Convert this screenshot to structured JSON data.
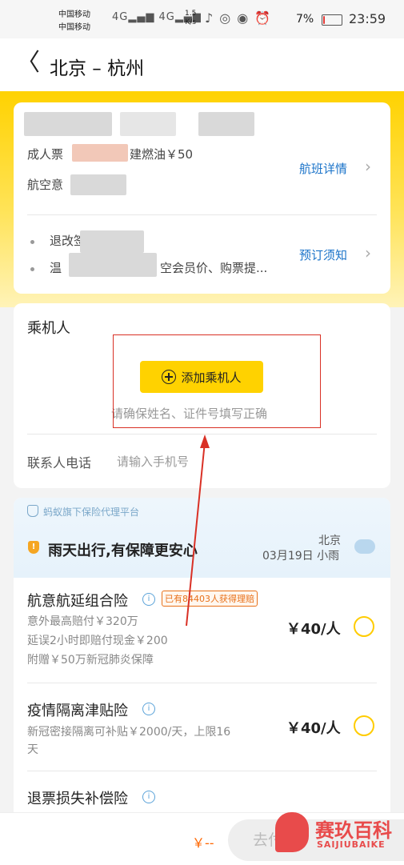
{
  "status_bar": {
    "carrier_1": "中国移动",
    "carrier_2": "中国移动",
    "signal": "4G▂▄▆ 4G▂▄▆",
    "speed_value": "1.5",
    "speed_unit": "K/s",
    "battery_pct": "7%",
    "battery_level": 0.07,
    "time": "23:59"
  },
  "header": {
    "back_glyph": "〈",
    "route": "北京 – 杭州"
  },
  "flight_card": {
    "adult_ticket": "成人票",
    "fuel": "建燃油￥50",
    "insurance": "航空意",
    "flight_details": "航班详情",
    "refund": "退改签",
    "tip": "温",
    "tip_tail": "空会员价、购票提...",
    "booking_notice": "预订须知"
  },
  "passenger": {
    "title": "乘机人",
    "add_button": "添加乘机人",
    "hint": "请确保姓名、证件号填写正确",
    "contact_label": "联系人电话",
    "contact_placeholder": "请输入手机号"
  },
  "insurance": {
    "platform": "蚂蚁旗下保险代理平台",
    "banner_title": "雨天出行,有保障更安心",
    "weather_city": "北京",
    "weather_date": "03月19日 小雨",
    "items": [
      {
        "name": "航意航延组合险",
        "badge": "已有84403人获得理赔",
        "desc_1": "意外最高赔付￥320万",
        "desc_2": "延误2小时即赔付现金￥200",
        "desc_3": "附赠￥50万新冠肺炎保障",
        "price": "￥40/人"
      },
      {
        "name": "疫情隔离津贴险",
        "desc_1": "新冠密接隔离可补贴￥2000/天，上限16",
        "desc_2": "天",
        "price": "￥40/人"
      },
      {
        "name": "退票损失补偿险"
      }
    ]
  },
  "bottom_bar": {
    "total": "￥--",
    "go_button": "去付"
  },
  "watermark": {
    "title": "赛玖百科",
    "subtitle": "SAIJIUBAIKE"
  },
  "colors": {
    "accent_yellow": "#ffd200",
    "link_blue": "#1a73c9",
    "annotation_red": "#d93025",
    "claim_orange": "#e8711a"
  }
}
